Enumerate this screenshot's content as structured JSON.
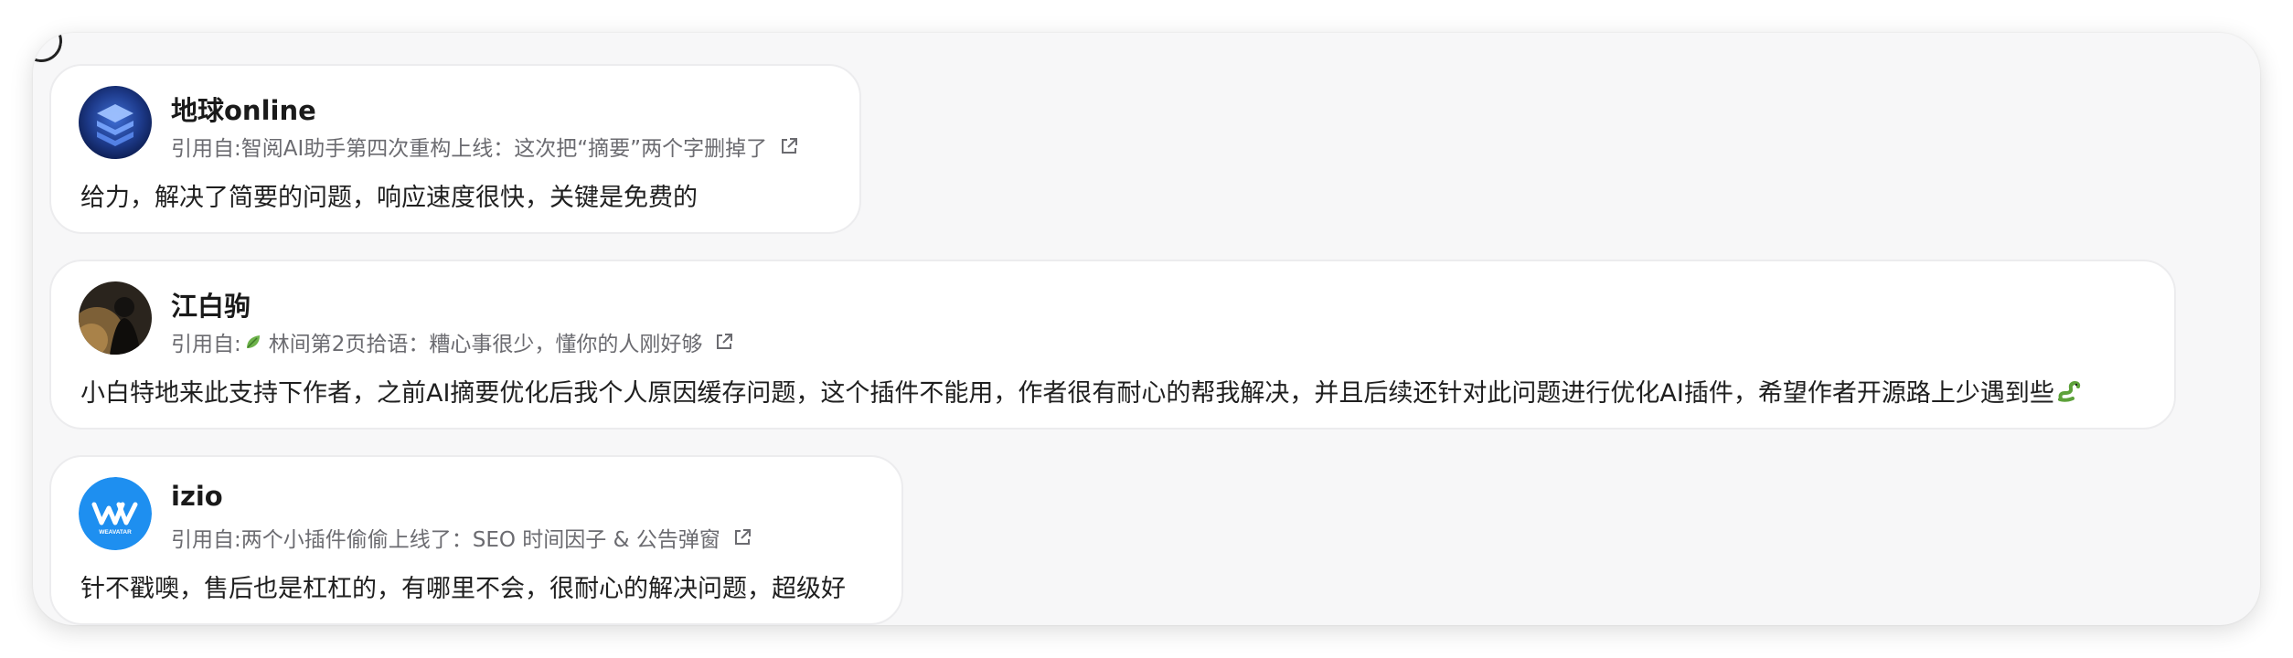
{
  "comments": [
    {
      "name": "地球online",
      "quote_prefix": "引用自: ",
      "quote_title": "智阅AI助手第四次重构上线：这次把“摘要”两个字删掉了",
      "content": "给力，解决了简要的问题，响应速度很快，关键是免费的",
      "avatar_icon": "layered-cube-avatar"
    },
    {
      "name": "江白驹",
      "quote_prefix": "引用自: ",
      "quote_title": "林间第2页拾语：糟心事很少，懂你的人刚好够",
      "content": "小白特地来此支持下作者，之前AI摘要优化后我个人原因缓存问题，这个插件不能用，作者很有耐心的帮我解决，并且后续还针对此问题进行优化AI插件，希望作者开源路上少遇到些",
      "avatar_icon": "dark-photo-avatar",
      "quote_icon": "leaf-icon",
      "content_icon": "snake-emoji-icon"
    },
    {
      "name": "izio",
      "quote_prefix": "引用自: ",
      "quote_title": "两个小插件偷偷上线了：SEO 时间因子 & 公告弹窗",
      "content": "针不戳噢，售后也是杠杠的，有哪里不会，很耐心的解决问题，超级好",
      "avatar_icon": "weavatar-logo-avatar",
      "avatar_text": "WEAVATAR"
    }
  ],
  "colors": {
    "panel_bg": "#f7f7f8",
    "card_bg": "#ffffff",
    "name": "#1a1a1a",
    "quote": "#6b6b70",
    "content": "#1f1f1f",
    "weavatar_blue": "#1e8ff0"
  }
}
